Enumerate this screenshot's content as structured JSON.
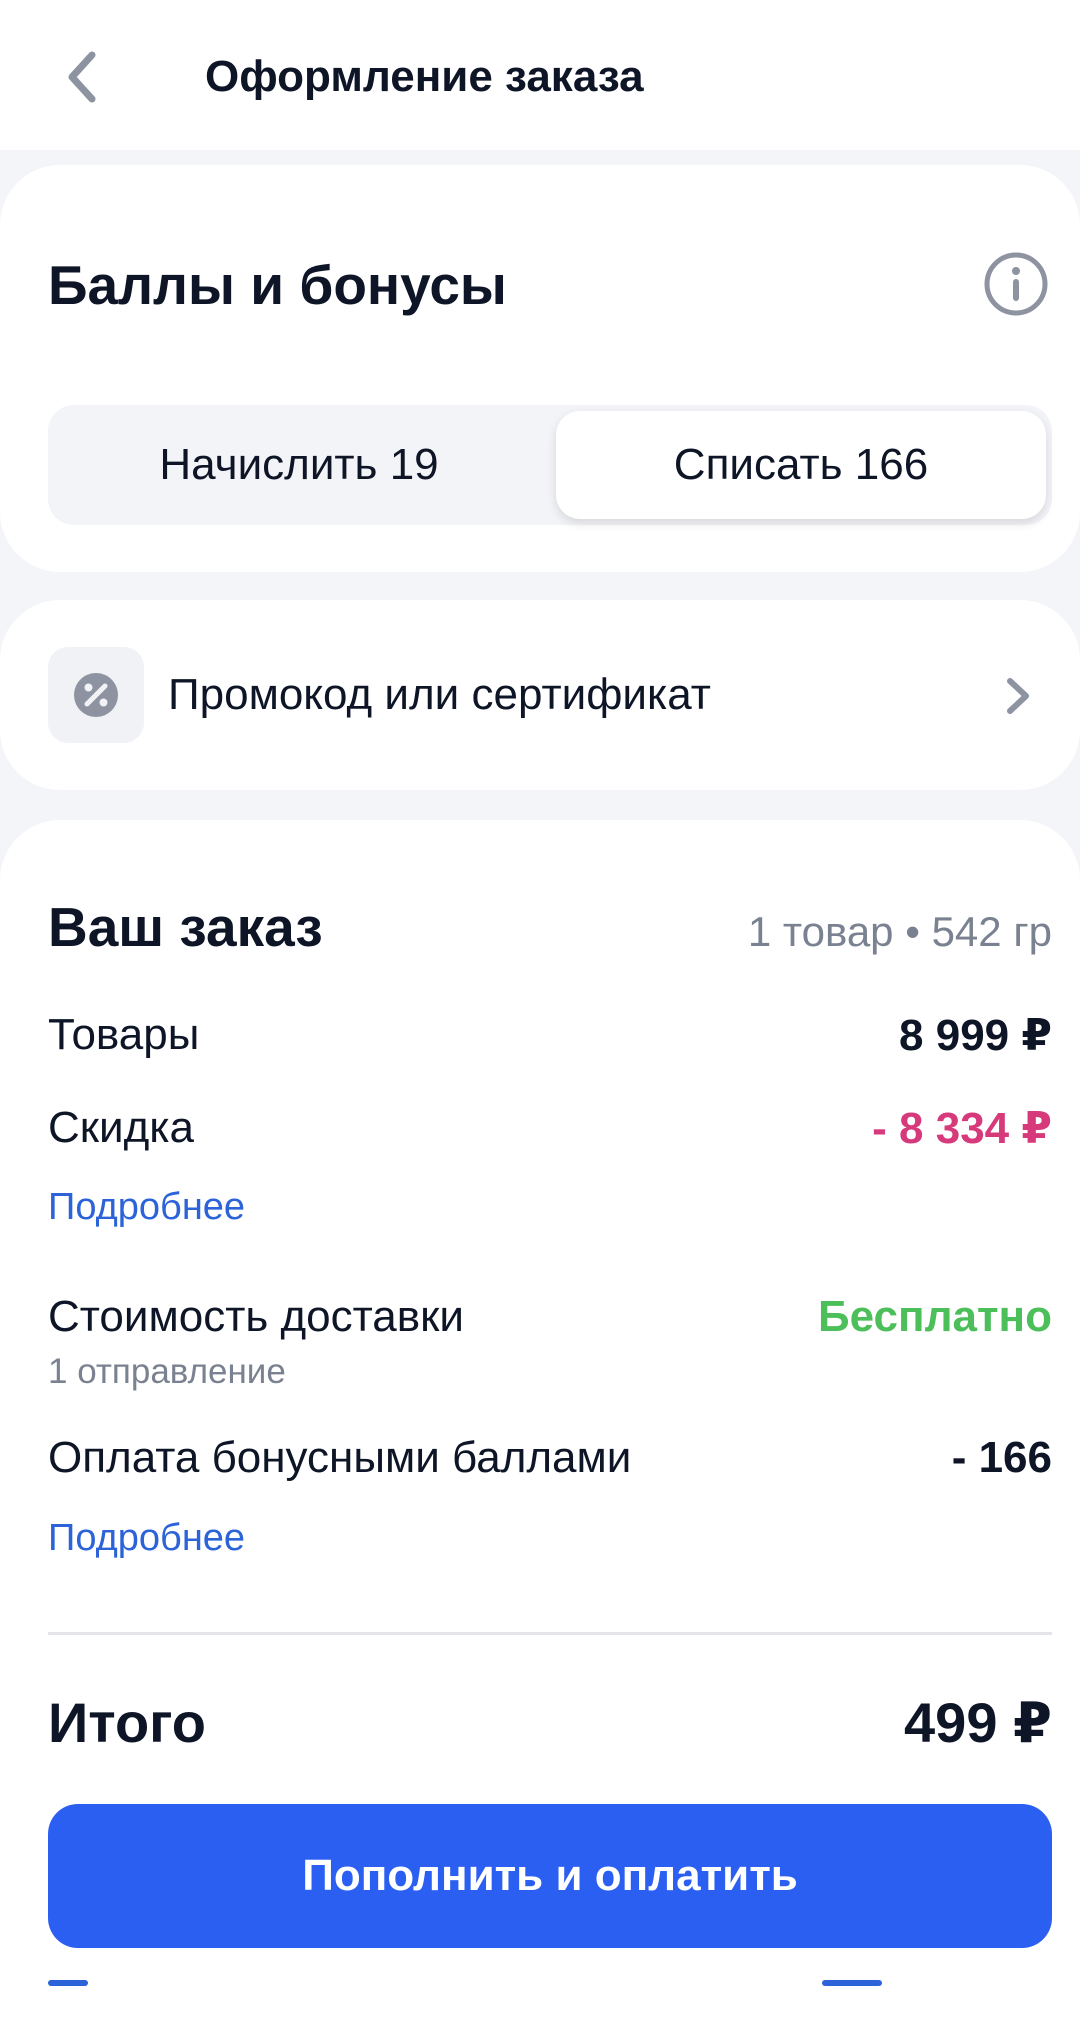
{
  "header": {
    "title": "Оформление заказа"
  },
  "bonus": {
    "title": "Баллы и бонусы",
    "accrue_label": "Начислить 19",
    "spend_label": "Списать 166",
    "selected": "spend"
  },
  "promo": {
    "label": "Промокод или сертификат"
  },
  "order": {
    "title": "Ваш заказ",
    "meta": "1 товар • 542 гр",
    "goods_label": "Товары",
    "goods_value": "8 999 ₽",
    "discount_label": "Скидка",
    "discount_value": "- 8 334 ₽",
    "discount_more": "Подробнее",
    "delivery_label": "Стоимость доставки",
    "delivery_sub": "1 отправление",
    "delivery_value": "Бесплатно",
    "bonus_pay_label": "Оплата бонусными баллами",
    "bonus_pay_value": "- 166",
    "bonus_more": "Подробнее",
    "total_label": "Итого",
    "total_value": "499 ₽",
    "pay_button": "Пополнить и оплатить"
  },
  "colors": {
    "accent": "#2b5ff2",
    "discount": "#d63a7a",
    "free": "#4cbf5a",
    "link": "#2c63d8"
  }
}
